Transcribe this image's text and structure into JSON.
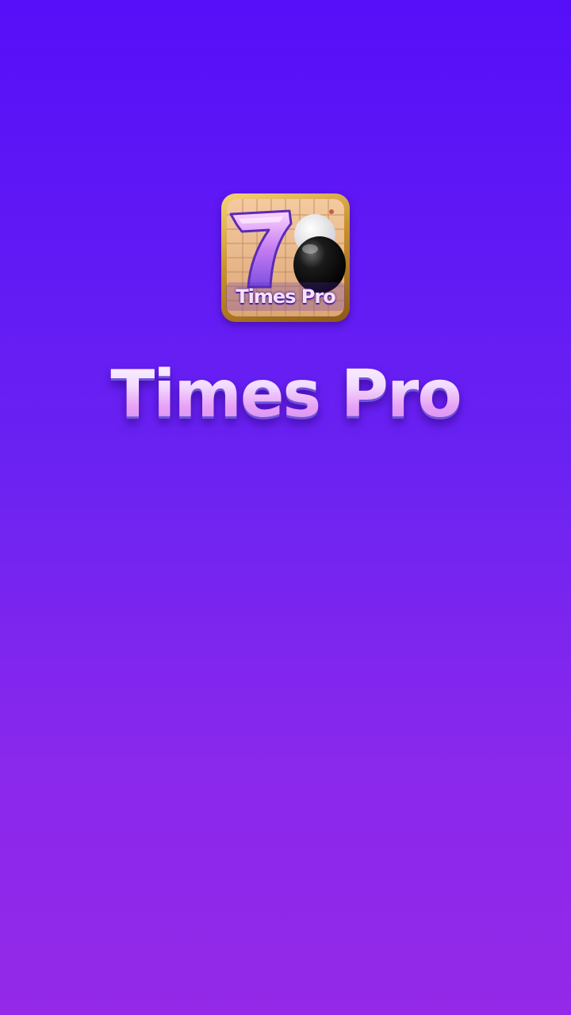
{
  "splash": {
    "app_name": "Times Pro",
    "icon": {
      "name": "times-pro-app-icon",
      "badge_text": "Times Pro",
      "numeral": "7"
    }
  },
  "colors": {
    "background_top": "#560ff8",
    "background_bottom": "#9429e8",
    "wordmark_light": "#f6e6ff",
    "wordmark_pink": "#e7a2f5",
    "icon_frame_gold": "#c8902e",
    "icon_board": "#e8b98a"
  }
}
